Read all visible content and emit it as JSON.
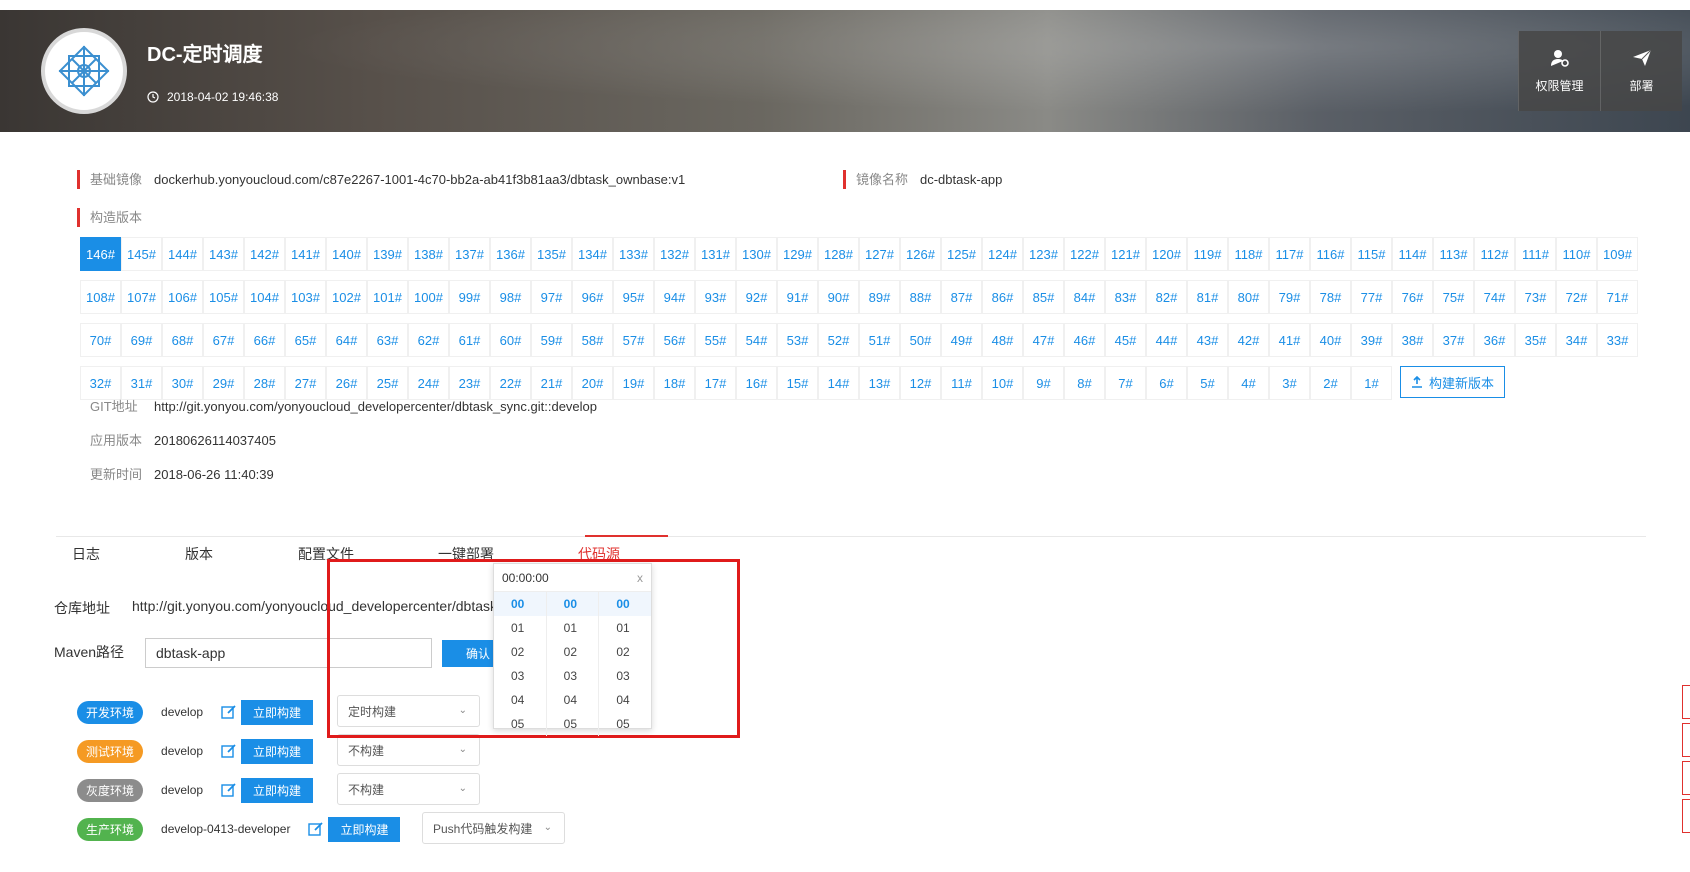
{
  "header": {
    "title": "DC-定时调度",
    "timestamp": "2018-04-02 19:46:38",
    "buttons": [
      {
        "label": "权限管理",
        "icon": "user-gear-icon"
      },
      {
        "label": "部署",
        "icon": "paper-plane-icon"
      }
    ]
  },
  "info": {
    "base_image_label": "基础镜像",
    "base_image_value": "dockerhub.yonyoucloud.com/c87e2267-1001-4c70-bb2a-ab41f3b81aa3/dbtask_ownbase:v1",
    "image_name_label": "镜像名称",
    "image_name_value": "dc-dbtask-app",
    "build_version_label": "构造版本",
    "git_label": "GIT地址",
    "git_value": "http://git.yonyou.com/yonyoucloud_developercenter/dbtask_sync.git::develop",
    "app_version_label": "应用版本",
    "app_version_value": "20180626114037405",
    "updated_label": "更新时间",
    "updated_value": "2018-06-26 11:40:39"
  },
  "versions": {
    "active": "146#",
    "build_new_label": "构建新版本",
    "rows": [
      [
        "146#",
        "145#",
        "144#",
        "143#",
        "142#",
        "141#",
        "140#",
        "139#",
        "138#",
        "137#",
        "136#",
        "135#",
        "134#",
        "133#",
        "132#",
        "131#",
        "130#",
        "129#",
        "128#",
        "127#",
        "126#",
        "125#",
        "124#",
        "123#",
        "122#",
        "121#",
        "120#",
        "119#",
        "118#",
        "117#",
        "116#",
        "115#",
        "114#",
        "113#",
        "112#",
        "111#",
        "110#",
        "109#"
      ],
      [
        "108#",
        "107#",
        "106#",
        "105#",
        "104#",
        "103#",
        "102#",
        "101#",
        "100#",
        "99#",
        "98#",
        "97#",
        "96#",
        "95#",
        "94#",
        "93#",
        "92#",
        "91#",
        "90#",
        "89#",
        "88#",
        "87#",
        "86#",
        "85#",
        "84#",
        "83#",
        "82#",
        "81#",
        "80#",
        "79#",
        "78#",
        "77#",
        "76#",
        "75#",
        "74#",
        "73#",
        "72#",
        "71#"
      ],
      [
        "70#",
        "69#",
        "68#",
        "67#",
        "66#",
        "65#",
        "64#",
        "63#",
        "62#",
        "61#",
        "60#",
        "59#",
        "58#",
        "57#",
        "56#",
        "55#",
        "54#",
        "53#",
        "52#",
        "51#",
        "50#",
        "49#",
        "48#",
        "47#",
        "46#",
        "45#",
        "44#",
        "43#",
        "42#",
        "41#",
        "40#",
        "39#",
        "38#",
        "37#",
        "36#",
        "35#",
        "34#",
        "33#"
      ],
      [
        "32#",
        "31#",
        "30#",
        "29#",
        "28#",
        "27#",
        "26#",
        "25#",
        "24#",
        "23#",
        "22#",
        "21#",
        "20#",
        "19#",
        "18#",
        "17#",
        "16#",
        "15#",
        "14#",
        "13#",
        "12#",
        "11#",
        "10#",
        "9#",
        "8#",
        "7#",
        "6#",
        "5#",
        "4#",
        "3#",
        "2#",
        "1#"
      ]
    ]
  },
  "tabs": [
    {
      "label": "日志"
    },
    {
      "label": "版本"
    },
    {
      "label": "配置文件"
    },
    {
      "label": "一键部署"
    },
    {
      "label": "代码源",
      "active": true
    }
  ],
  "code_source": {
    "repo_label": "仓库地址",
    "repo_value": "http://git.yonyou.com/yonyoucloud_developercenter/dbtask_",
    "maven_label": "Maven路径",
    "maven_value": "dbtask-app",
    "confirm_label": "确认"
  },
  "environments": [
    {
      "badge": "开发环境",
      "color": "#1a8ee6",
      "branch": "develop",
      "build_label": "立即构建",
      "trigger": "定时构建"
    },
    {
      "badge": "测试环境",
      "color": "#f59a23",
      "branch": "develop",
      "build_label": "立即构建",
      "trigger": "不构建"
    },
    {
      "badge": "灰度环境",
      "color": "#8c8c8c",
      "branch": "develop",
      "build_label": "立即构建",
      "trigger": "不构建"
    },
    {
      "badge": "生产环境",
      "color": "#52b34e",
      "branch": "develop-0413-developer",
      "build_label": "立即构建",
      "trigger": "Push代码触发构建"
    }
  ],
  "time_picker": {
    "value": "00:00:00",
    "close": "x",
    "hours": [
      "00",
      "01",
      "02",
      "03",
      "04",
      "05"
    ],
    "minutes": [
      "00",
      "01",
      "02",
      "03",
      "04",
      "05"
    ],
    "seconds": [
      "00",
      "01",
      "02",
      "03",
      "04",
      "05"
    ],
    "selected": "00"
  }
}
